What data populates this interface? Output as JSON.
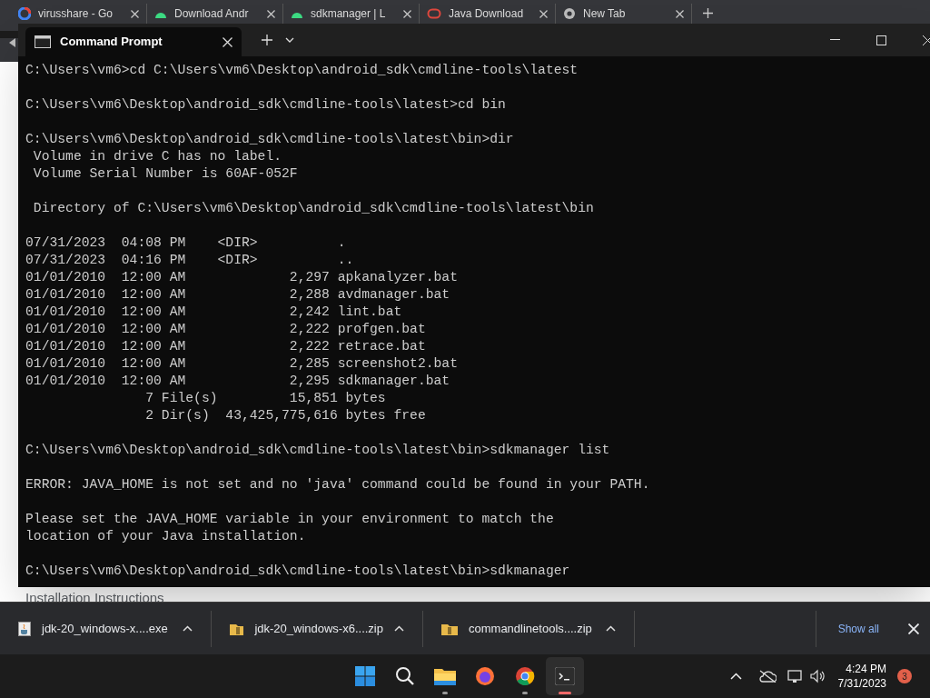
{
  "browser": {
    "tabs": [
      {
        "title": "virusshare - Go",
        "kind": "google"
      },
      {
        "title": "Download Andr",
        "kind": "android"
      },
      {
        "title": "sdkmanager | L",
        "kind": "android"
      },
      {
        "title": "Java Download",
        "kind": "oracle"
      },
      {
        "title": "New Tab",
        "kind": "chrome"
      }
    ],
    "page_heading": "Installation Instructions"
  },
  "terminal": {
    "tab_title": "Command Prompt",
    "blocks": [
      [
        "C:\\Users\\vm6>cd C:\\Users\\vm6\\Desktop\\android_sdk\\cmdline-tools\\latest"
      ],
      [
        "C:\\Users\\vm6\\Desktop\\android_sdk\\cmdline-tools\\latest>cd bin"
      ],
      [
        "C:\\Users\\vm6\\Desktop\\android_sdk\\cmdline-tools\\latest\\bin>dir",
        " Volume in drive C has no label.",
        " Volume Serial Number is 60AF-052F"
      ],
      [
        " Directory of C:\\Users\\vm6\\Desktop\\android_sdk\\cmdline-tools\\latest\\bin"
      ],
      [
        "07/31/2023  04:08 PM    <DIR>          .",
        "07/31/2023  04:16 PM    <DIR>          ..",
        "01/01/2010  12:00 AM             2,297 apkanalyzer.bat",
        "01/01/2010  12:00 AM             2,288 avdmanager.bat",
        "01/01/2010  12:00 AM             2,242 lint.bat",
        "01/01/2010  12:00 AM             2,222 profgen.bat",
        "01/01/2010  12:00 AM             2,222 retrace.bat",
        "01/01/2010  12:00 AM             2,285 screenshot2.bat",
        "01/01/2010  12:00 AM             2,295 sdkmanager.bat",
        "               7 File(s)         15,851 bytes",
        "               2 Dir(s)  43,425,775,616 bytes free"
      ],
      [
        "C:\\Users\\vm6\\Desktop\\android_sdk\\cmdline-tools\\latest\\bin>sdkmanager list"
      ],
      [
        "ERROR: JAVA_HOME is not set and no 'java' command could be found in your PATH."
      ],
      [
        "Please set the JAVA_HOME variable in your environment to match the",
        "location of your Java installation."
      ],
      [
        "C:\\Users\\vm6\\Desktop\\android_sdk\\cmdline-tools\\latest\\bin>sdkmanager"
      ]
    ]
  },
  "downloads": {
    "items": [
      {
        "name": "jdk-20_windows-x....exe",
        "kind": "installer"
      },
      {
        "name": "jdk-20_windows-x6....zip",
        "kind": "archive"
      },
      {
        "name": "commandlinetools....zip",
        "kind": "archive"
      }
    ],
    "show_all": "Show all"
  },
  "taskbar": {
    "apps": [
      {
        "kind": "start",
        "running": false,
        "selected": false
      },
      {
        "kind": "search",
        "running": false,
        "selected": false
      },
      {
        "kind": "explorer",
        "running": true,
        "selected": false
      },
      {
        "kind": "firefox",
        "running": false,
        "selected": false
      },
      {
        "kind": "chrome",
        "running": true,
        "selected": false
      },
      {
        "kind": "terminal",
        "running": true,
        "selected": true
      }
    ],
    "time": "4:24 PM",
    "date": "7/31/2023",
    "notification_count": "3"
  }
}
